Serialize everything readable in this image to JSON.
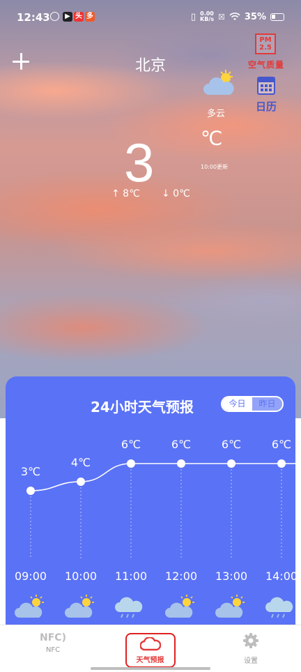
{
  "status_bar": {
    "time": "12:43",
    "net_speed_value": "0.00",
    "net_speed_unit": "KB/s",
    "battery": "35%"
  },
  "header": {
    "city": "北京",
    "air_quality_icon": "PM 2.5",
    "air_quality_label": "空气质量",
    "calendar_label": "日历"
  },
  "current": {
    "condition": "多云",
    "temperature": "3",
    "unit": "℃",
    "updated": "10:00更新",
    "high": "↑ 8℃",
    "low": "↓ 0℃",
    "icon": "partly-cloudy-icon"
  },
  "forecast_card": {
    "title": "24小时天气预报",
    "tab_today": "今日",
    "tab_yesterday": "昨日",
    "colors": {
      "background": "#5a72f5",
      "line": "#ffffff"
    }
  },
  "chart_data": {
    "type": "line",
    "title": "24小时天气预报",
    "x": [
      "09:00",
      "10:00",
      "11:00",
      "12:00",
      "13:00",
      "14:00"
    ],
    "series": [
      {
        "values": [
          3,
          4,
          6,
          6,
          6,
          6
        ]
      }
    ],
    "point_labels": [
      "3℃",
      "4℃",
      "6℃",
      "6℃",
      "6℃",
      "6℃"
    ],
    "icons": [
      "partly-cloudy-icon",
      "partly-cloudy-icon",
      "rain-icon",
      "partly-cloudy-icon",
      "partly-cloudy-icon",
      "rain-icon"
    ],
    "unit": "℃"
  },
  "bottom_nav": {
    "nfc_glyph": "NFC",
    "nfc_label": "NFC",
    "weather_label": "天气预报",
    "settings_label": "设置"
  }
}
